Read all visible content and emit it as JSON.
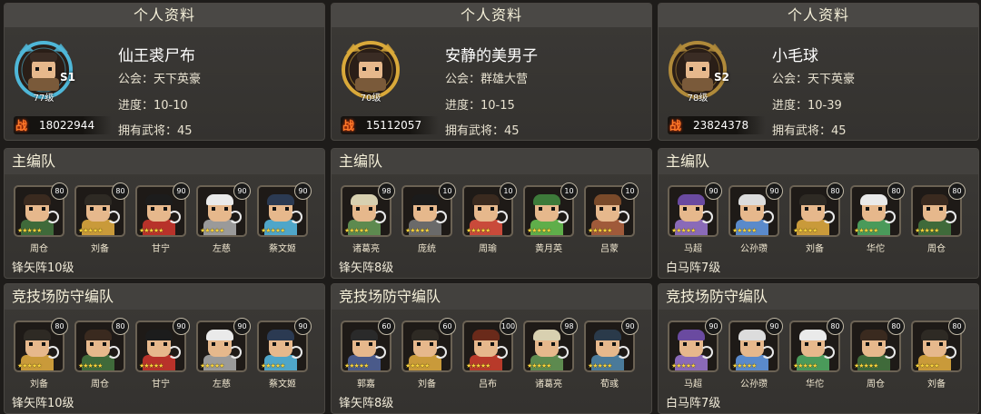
{
  "players": [
    {
      "profile_title": "个人资料",
      "name": "仙王裘尸布",
      "guild": "公会：天下英豪",
      "progress": "进度：10-10",
      "generals": "拥有武将：45",
      "level": "77级",
      "rank_tag": "S1",
      "power_icon": "战",
      "power": "18022944",
      "frame_color": "#4fb7d8",
      "main": {
        "title": "主编队",
        "formation": "锋矢阵10级",
        "heroes": [
          {
            "name": "周仓",
            "level": "80",
            "hair": "#3a2a1f",
            "body": "#3f6a3a"
          },
          {
            "name": "刘备",
            "level": "80",
            "hair": "#2e2a24",
            "body": "#c99a3a"
          },
          {
            "name": "甘宁",
            "level": "90",
            "hair": "#1c1c1c",
            "body": "#b8322a"
          },
          {
            "name": "左慈",
            "level": "90",
            "hair": "#eaeaea",
            "body": "#9a9a9a"
          },
          {
            "name": "蔡文姬",
            "level": "90",
            "hair": "#2b3a52",
            "body": "#4fa6c9"
          }
        ]
      },
      "arena": {
        "title": "竞技场防守编队",
        "formation": "锋矢阵10级",
        "heroes": [
          {
            "name": "刘备",
            "level": "80",
            "hair": "#2e2a24",
            "body": "#c99a3a"
          },
          {
            "name": "周仓",
            "level": "80",
            "hair": "#3a2a1f",
            "body": "#3f6a3a"
          },
          {
            "name": "甘宁",
            "level": "90",
            "hair": "#1c1c1c",
            "body": "#b8322a"
          },
          {
            "name": "左慈",
            "level": "90",
            "hair": "#eaeaea",
            "body": "#9a9a9a"
          },
          {
            "name": "蔡文姬",
            "level": "90",
            "hair": "#2b3a52",
            "body": "#4fa6c9"
          }
        ]
      }
    },
    {
      "profile_title": "个人资料",
      "name": "安静的美男子",
      "guild": "公会：群雄大营",
      "progress": "进度：10-15",
      "generals": "拥有武将：45",
      "level": "70级",
      "rank_tag": "",
      "power_icon": "战",
      "power": "15112057",
      "frame_color": "#d9a93a",
      "main": {
        "title": "主编队",
        "formation": "锋矢阵8级",
        "heroes": [
          {
            "name": "诸葛亮",
            "level": "98",
            "hair": "#d8d0b0",
            "body": "#5d8a4f"
          },
          {
            "name": "庞统",
            "level": "10",
            "hair": "#1b1b1b",
            "body": "#6a6a6a"
          },
          {
            "name": "周瑜",
            "level": "10",
            "hair": "#3a2a1f",
            "body": "#c94a3a"
          },
          {
            "name": "黄月英",
            "level": "10",
            "hair": "#3d7a3a",
            "body": "#5fae4a"
          },
          {
            "name": "吕蒙",
            "level": "10",
            "hair": "#7a4a2a",
            "body": "#a05a3a"
          }
        ]
      },
      "arena": {
        "title": "竞技场防守编队",
        "formation": "锋矢阵8级",
        "heroes": [
          {
            "name": "郭嘉",
            "level": "60",
            "hair": "#2a2a2a",
            "body": "#4a5a8a"
          },
          {
            "name": "刘备",
            "level": "60",
            "hair": "#2e2a24",
            "body": "#c99a3a"
          },
          {
            "name": "吕布",
            "level": "100",
            "hair": "#6a2a1a",
            "body": "#b83a2a"
          },
          {
            "name": "诸葛亮",
            "level": "98",
            "hair": "#d8d0b0",
            "body": "#5d8a4f"
          },
          {
            "name": "荀彧",
            "level": "90",
            "hair": "#2a3a4a",
            "body": "#4a7a9a"
          }
        ]
      }
    },
    {
      "profile_title": "个人资料",
      "name": "小毛球",
      "guild": "公会：天下英豪",
      "progress": "进度：10-39",
      "generals": "拥有武将：45",
      "level": "78级",
      "rank_tag": "S2",
      "power_icon": "战",
      "power": "23824378",
      "frame_color": "#b08a3a",
      "main": {
        "title": "主编队",
        "formation": "白马阵7级",
        "heroes": [
          {
            "name": "马超",
            "level": "90",
            "hair": "#6a4aa0",
            "body": "#8a6ab8"
          },
          {
            "name": "公孙瓒",
            "level": "90",
            "hair": "#dcdcdc",
            "body": "#5a8acb"
          },
          {
            "name": "刘备",
            "level": "80",
            "hair": "#2e2a24",
            "body": "#c99a3a"
          },
          {
            "name": "华佗",
            "level": "80",
            "hair": "#eaeaea",
            "body": "#4a9a5a"
          },
          {
            "name": "周仓",
            "level": "80",
            "hair": "#3a2a1f",
            "body": "#3f6a3a"
          }
        ]
      },
      "arena": {
        "title": "竞技场防守编队",
        "formation": "白马阵7级",
        "heroes": [
          {
            "name": "马超",
            "level": "90",
            "hair": "#6a4aa0",
            "body": "#8a6ab8"
          },
          {
            "name": "公孙瓒",
            "level": "90",
            "hair": "#dcdcdc",
            "body": "#5a8acb"
          },
          {
            "name": "华佗",
            "level": "80",
            "hair": "#eaeaea",
            "body": "#4a9a5a"
          },
          {
            "name": "周仓",
            "level": "80",
            "hair": "#3a2a1f",
            "body": "#3f6a3a"
          },
          {
            "name": "刘备",
            "level": "80",
            "hair": "#2e2a24",
            "body": "#c99a3a"
          }
        ]
      }
    }
  ]
}
